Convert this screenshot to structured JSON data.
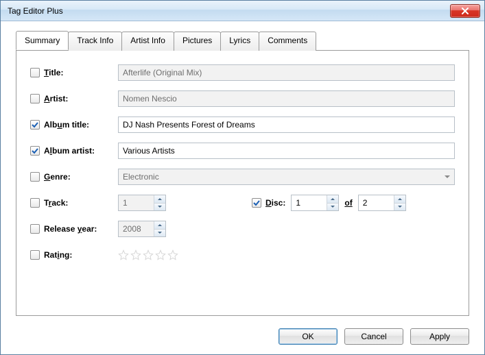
{
  "window": {
    "title": "Tag Editor Plus"
  },
  "tabs": [
    "Summary",
    "Track Info",
    "Artist Info",
    "Pictures",
    "Lyrics",
    "Comments"
  ],
  "active_tab": 0,
  "fields": {
    "title": {
      "label": "Title:",
      "checked": false,
      "value": "Afterlife (Original Mix)",
      "enabled": false
    },
    "artist": {
      "label": "Artist:",
      "checked": false,
      "value": "Nomen Nescio",
      "enabled": false
    },
    "album_title": {
      "label": "Album title:",
      "checked": true,
      "value": "DJ Nash Presents Forest of Dreams",
      "enabled": true
    },
    "album_artist": {
      "label": "Album artist:",
      "checked": true,
      "value": "Various Artists",
      "enabled": true
    },
    "genre": {
      "label": "Genre:",
      "checked": false,
      "value": "Electronic",
      "enabled": false
    },
    "track": {
      "label": "Track:",
      "checked": false,
      "value": "1",
      "enabled": false
    },
    "disc": {
      "label": "Disc:",
      "checked": true,
      "value": "1",
      "of_label": "of",
      "of_value": "2",
      "enabled": true
    },
    "release_year": {
      "label": "Release year:",
      "checked": false,
      "value": "2008",
      "enabled": false
    },
    "rating": {
      "label": "Rating:",
      "checked": false,
      "value": 0
    }
  },
  "buttons": {
    "ok": "OK",
    "cancel": "Cancel",
    "apply": "Apply"
  }
}
